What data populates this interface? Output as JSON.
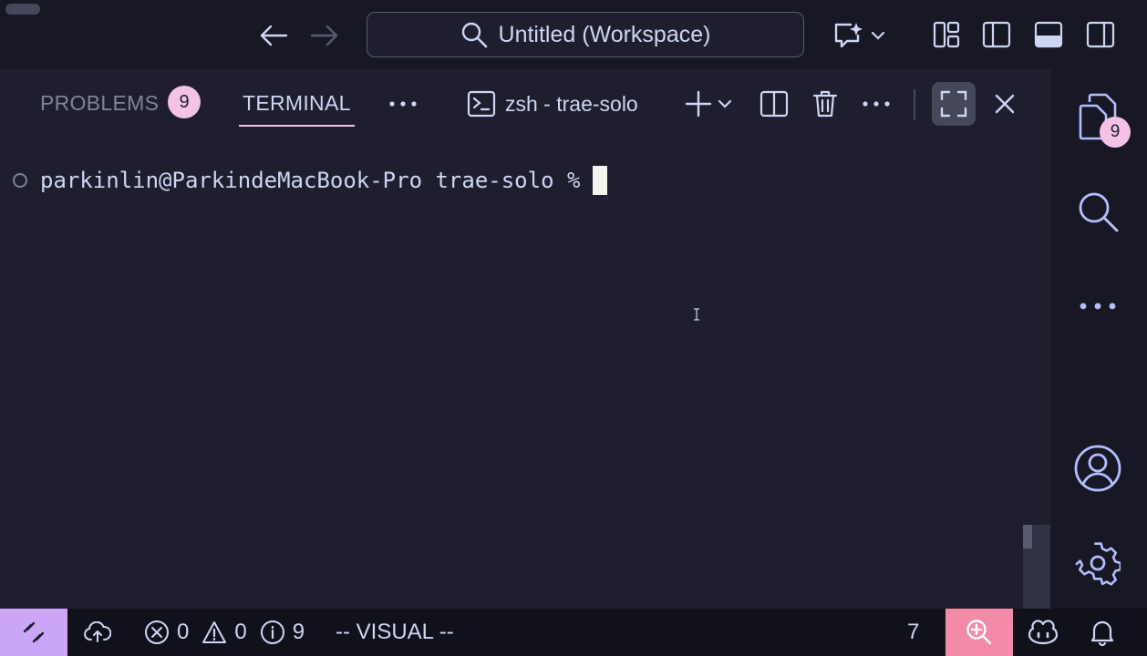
{
  "titlebar": {
    "search_text": "Untitled (Workspace)"
  },
  "panel": {
    "tabs": [
      {
        "label": "PROBLEMS",
        "badge": "9"
      },
      {
        "label": "TERMINAL"
      }
    ],
    "terminal_name": "zsh - trae-solo"
  },
  "terminal": {
    "prompt": "parkinlin@ParkindeMacBook-Pro trae-solo %"
  },
  "activitybar": {
    "explorer_badge": "9"
  },
  "statusbar": {
    "errors": "0",
    "warnings": "0",
    "infos": "9",
    "mode": "-- VISUAL --",
    "count": "7"
  },
  "colors": {
    "accent_pink": "#f5c2e7",
    "remote_purple": "#cba6f7",
    "zoom_red": "#f38ba8",
    "background": "#1e1e2e"
  },
  "icons": [
    "arrow-left-icon",
    "arrow-right-icon",
    "search-icon",
    "ai-sparkle-icon",
    "chevron-down-icon",
    "layout-customize-icon",
    "toggle-sidebar-icon",
    "toggle-panel-icon",
    "toggle-secondary-sidebar-icon",
    "terminal-icon",
    "plus-icon",
    "split-icon",
    "trash-icon",
    "more-icon",
    "maximize-icon",
    "close-icon",
    "files-icon",
    "user-icon",
    "gear-icon",
    "remote-icon",
    "cloud-upload-icon",
    "error-icon",
    "warning-icon",
    "info-icon",
    "zoom-in-icon",
    "copilot-icon",
    "bell-icon"
  ]
}
